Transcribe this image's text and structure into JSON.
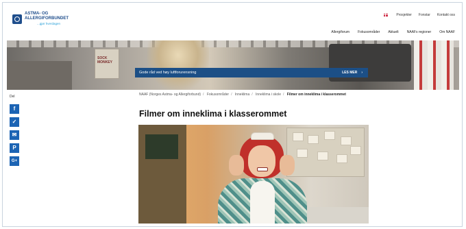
{
  "header": {
    "logo": {
      "line1": "ASTMA- OG",
      "line2": "ALLERGIFORBUNDET",
      "tagline": "...gjør hverdagen"
    },
    "utility": [
      {
        "label": "Prosjekter",
        "type": "link"
      },
      {
        "label": "Fonstar",
        "type": "link"
      },
      {
        "label": "Kontakt oss",
        "type": "link"
      }
    ],
    "nav": [
      "Allergiforum",
      "Fokusområder",
      "Aktuelt",
      "NAAFs regioner",
      "Om NAAF"
    ]
  },
  "hero": {
    "box_text": "SOCK MONKEY",
    "banner_text": "Gode råd ved høy luftforurensning",
    "banner_button": "LES MER"
  },
  "share": {
    "label": "Del",
    "icons": [
      {
        "name": "facebook-icon",
        "glyph": "f"
      },
      {
        "name": "twitter-icon",
        "glyph": "🐦"
      },
      {
        "name": "email-icon",
        "glyph": "✉"
      },
      {
        "name": "pinterest-icon",
        "glyph": "P"
      },
      {
        "name": "google-plus-icon",
        "glyph": "G+"
      }
    ]
  },
  "breadcrumb": [
    "NAAF (Norges Astma- og Allergiforbund)",
    "Fokusområder",
    "Inneklima",
    "Inneklima i skole",
    "Filmer om inneklima i klasserommet"
  ],
  "page": {
    "title": "Filmer om inneklima i klasserommet"
  },
  "colors": {
    "brand": "#1f4e8c",
    "banner": "#1c4f86",
    "share": "#1c64b4"
  }
}
